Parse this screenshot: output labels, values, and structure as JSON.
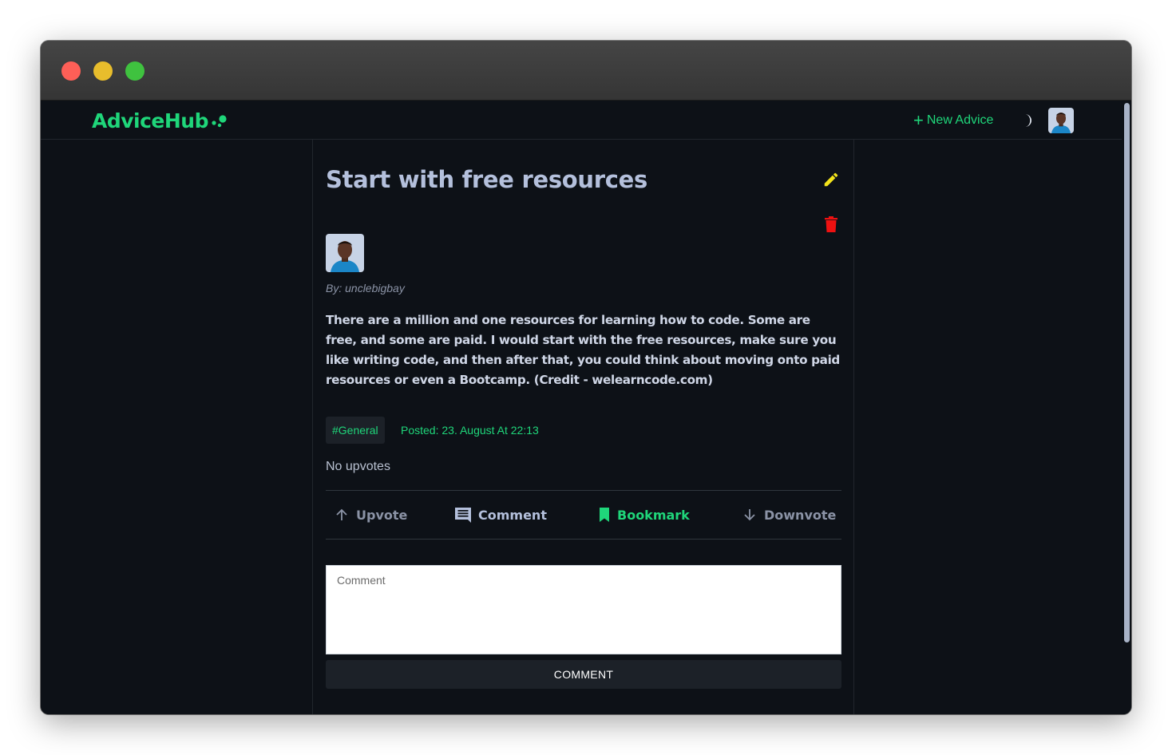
{
  "app": {
    "brand": "AdviceHub",
    "brand_color": "#1fd67a"
  },
  "navbar": {
    "new_advice_label": "New Advice",
    "theme_icon": "moon-icon",
    "avatar_icon": "user-avatar"
  },
  "post": {
    "title": "Start with free resources",
    "author": "By: unclebigbay",
    "body": "There are a million and one resources for learning how to code. Some are free, and some are paid. I would start with the free resources, make sure you like writing code, and then after that, you could think about moving onto paid resources or even a Bootcamp. (Credit - welearncode.com)",
    "tag": "#General",
    "posted": "Posted: 23. August At 22:13",
    "upvotes": "No upvotes"
  },
  "actions": {
    "upvote": "Upvote",
    "comment": "Comment",
    "bookmark": "Bookmark",
    "downvote": "Downvote"
  },
  "comment_form": {
    "placeholder": "Comment",
    "submit": "COMMENT"
  },
  "colors": {
    "edit_icon": "#f2e31b",
    "delete_icon": "#ee1111",
    "title": "#b4c0dc",
    "background": "#0d1117"
  }
}
